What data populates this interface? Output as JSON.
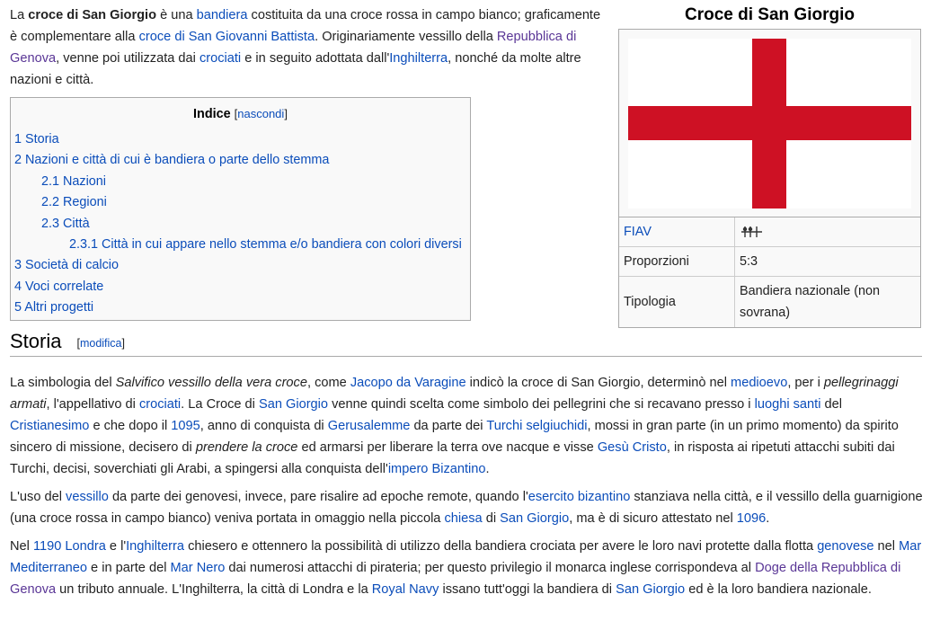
{
  "intro": {
    "t1": "La ",
    "b1": "croce di San Giorgio",
    "t2": " è una ",
    "l_bandiera": "bandiera",
    "t3": " costituita da una croce rossa in campo bianco; graficamente è complementare alla ",
    "l_croce_giovanni": "croce di San Giovanni Battista",
    "t4": ". Originariamente vessillo della ",
    "l_repubblica": "Repubblica di Genova",
    "t5": ", venne poi utilizzata dai ",
    "l_crociati": "crociati",
    "t6": " e in seguito adottata dall'",
    "l_inghilterra": "Inghilterra",
    "t7": ", nonché da molte altre nazioni e città."
  },
  "infobox": {
    "title": "Croce di San Giorgio",
    "flag_colors": {
      "field": "#ffffff",
      "cross": "#ce1124"
    },
    "rows": [
      {
        "label": "FIAV",
        "value": "",
        "icon": "fiav-symbol-icon"
      },
      {
        "label": "Proporzioni",
        "value": "5:3"
      },
      {
        "label": "Tipologia",
        "value": "Bandiera nazionale (non sovrana)"
      }
    ]
  },
  "toc": {
    "title": "Indice",
    "toggle": "nascondi",
    "items": [
      {
        "num": "1",
        "label": "Storia"
      },
      {
        "num": "2",
        "label": "Nazioni e città di cui è bandiera o parte dello stemma"
      },
      {
        "num": "2.1",
        "label": "Nazioni"
      },
      {
        "num": "2.2",
        "label": "Regioni"
      },
      {
        "num": "2.3",
        "label": "Città"
      },
      {
        "num": "2.3.1",
        "label": "Città in cui appare nello stemma e/o bandiera con colori diversi"
      },
      {
        "num": "3",
        "label": "Società di calcio"
      },
      {
        "num": "4",
        "label": "Voci correlate"
      },
      {
        "num": "5",
        "label": "Altri progetti"
      }
    ]
  },
  "section": {
    "title": "Storia",
    "edit": "modifica"
  },
  "p1": {
    "t1": "La simbologia del ",
    "i1": "Salvifico vessillo della vera croce",
    "t2": ", come ",
    "l_jacopo": "Jacopo da Varagine",
    "t3": " indicò la croce di San Giorgio, determinò nel ",
    "l_medioevo": "medioevo",
    "t4": ", per i ",
    "i2": "pellegrinaggi armati",
    "t5": ", l'appellativo di ",
    "l_crociati": "crociati",
    "t6": ". La Croce di ",
    "l_sangiorgio": "San Giorgio",
    "t7": " venne quindi scelta come simbolo dei pellegrini che si recavano presso i ",
    "l_luoghi": "luoghi santi",
    "t8": " del ",
    "l_cristianesimo": "Cristianesimo",
    "t9": " e che dopo il ",
    "l_1095": "1095",
    "t10": ", anno di conquista di ",
    "l_gerusalemme": "Gerusalemme",
    "t11": " da parte dei ",
    "l_turchi": "Turchi selgiuchidi",
    "t12": ", mossi in gran parte (in un primo momento) da spirito sincero di missione, decisero di ",
    "i3": "prendere la croce",
    "t13": " ed armarsi per liberare la terra ove nacque e visse ",
    "l_gesu": "Gesù Cristo",
    "t14": ", in risposta ai ripetuti attacchi subiti dai Turchi, decisi, soverchiati gli Arabi, a spingersi alla conquista dell'",
    "l_impero": "impero Bizantino",
    "t15": "."
  },
  "p2": {
    "t1": "L'uso del ",
    "l_vessillo": "vessillo",
    "t2": " da parte dei genovesi, invece, pare risalire ad epoche remote, quando l'",
    "l_esercito": "esercito bizantino",
    "t3": " stanziava nella città, e il vessillo della guarnigione (una croce rossa in campo bianco) veniva portata in omaggio nella piccola ",
    "l_chiesa": "chiesa",
    "t4": " di ",
    "l_sangiorgio": "San Giorgio",
    "t5": ", ma è di sicuro attestato nel ",
    "l_1096": "1096",
    "t6": "."
  },
  "p3": {
    "t1": "Nel ",
    "l_1190": "1190",
    "t2": " ",
    "l_londra": "Londra",
    "t3": " e l'",
    "l_inghilterra": "Inghilterra",
    "t4": " chiesero e ottennero la possibilità di utilizzo della bandiera crociata per avere le loro navi protette dalla flotta ",
    "l_genovese": "genovese",
    "t5": " nel ",
    "l_mediterraneo": "Mar Mediterraneo",
    "t6": " e in parte del ",
    "l_marnero": "Mar Nero",
    "t7": " dai numerosi attacchi di pirateria; per questo privilegio il monarca inglese corrispondeva al ",
    "l_doge": "Doge della Repubblica di Genova",
    "t8": " un tributo annuale. L'Inghilterra, la città di Londra e la ",
    "l_navy": "Royal Navy",
    "t9": " issano tutt'oggi la bandiera di ",
    "l_sangiorgio": "San Giorgio",
    "t10": " ed è la loro bandiera nazionale."
  }
}
